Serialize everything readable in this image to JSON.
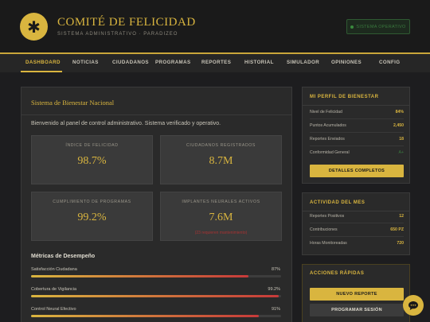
{
  "header": {
    "logo_symbol": "✱",
    "title": "COMITÉ DE FELICIDAD",
    "subtitle": "SISTEMA ADMINISTRATIVO · PARADIZEO",
    "status": "SISTEMA OPERATIVO"
  },
  "nav": {
    "items": [
      "DASHBOARD",
      "NOTICIAS",
      "CIUDADANOS",
      "PROGRAMAS",
      "REPORTES",
      "HISTORIAL",
      "SIMULADOR",
      "OPINIONES",
      "CONFIG"
    ],
    "active": "DASHBOARD"
  },
  "main": {
    "title": "Sistema de Bienestar Nacional",
    "welcome": "Bienvenido al panel de control administrativo. Sistema verificado y operativo.",
    "stats": [
      {
        "label": "ÍNDICE DE FELICIDAD",
        "value": "98.7%",
        "note": ""
      },
      {
        "label": "CIUDADANOS REGISTRADOS",
        "value": "8.7M",
        "note": ""
      },
      {
        "label": "CUMPLIMIENTO DE PROGRAMAS",
        "value": "99.2%",
        "note": ""
      },
      {
        "label": "IMPLANTES NEURALES ACTIVOS",
        "value": "7.6M",
        "note": "(23 requieren mantenimiento)"
      }
    ],
    "metrics_title": "Métricas de Desempeño",
    "metrics": [
      {
        "label": "Satisfacción Ciudadana",
        "value": "87%",
        "fraction": 0.87
      },
      {
        "label": "Cobertura de Vigilancia",
        "value": "99.2%",
        "fraction": 0.992
      },
      {
        "label": "Control Neural Efectivo",
        "value": "91%",
        "fraction": 0.91
      }
    ]
  },
  "profile": {
    "title": "MI PERFIL DE BIENESTAR",
    "rows": [
      {
        "key": "Nivel de Felicidad",
        "val": "84%"
      },
      {
        "key": "Puntos Acumulados",
        "val": "2,450"
      },
      {
        "key": "Reportes Enviados",
        "val": "18"
      },
      {
        "key": "Conformidad General",
        "val": "A+"
      }
    ],
    "button": "DETALLES COMPLETOS"
  },
  "activity": {
    "title": "ACTIVIDAD DEL MES",
    "rows": [
      {
        "key": "Reportes Positivos",
        "val": "12"
      },
      {
        "key": "Contribuciones",
        "val": "650 PZ"
      },
      {
        "key": "Horas Monitoreadas",
        "val": "720"
      }
    ]
  },
  "quick": {
    "title": "ACCIONES RÁPIDAS",
    "new_report": "NUEVO REPORTE",
    "schedule": "PROGRAMAR SESIÓN"
  }
}
